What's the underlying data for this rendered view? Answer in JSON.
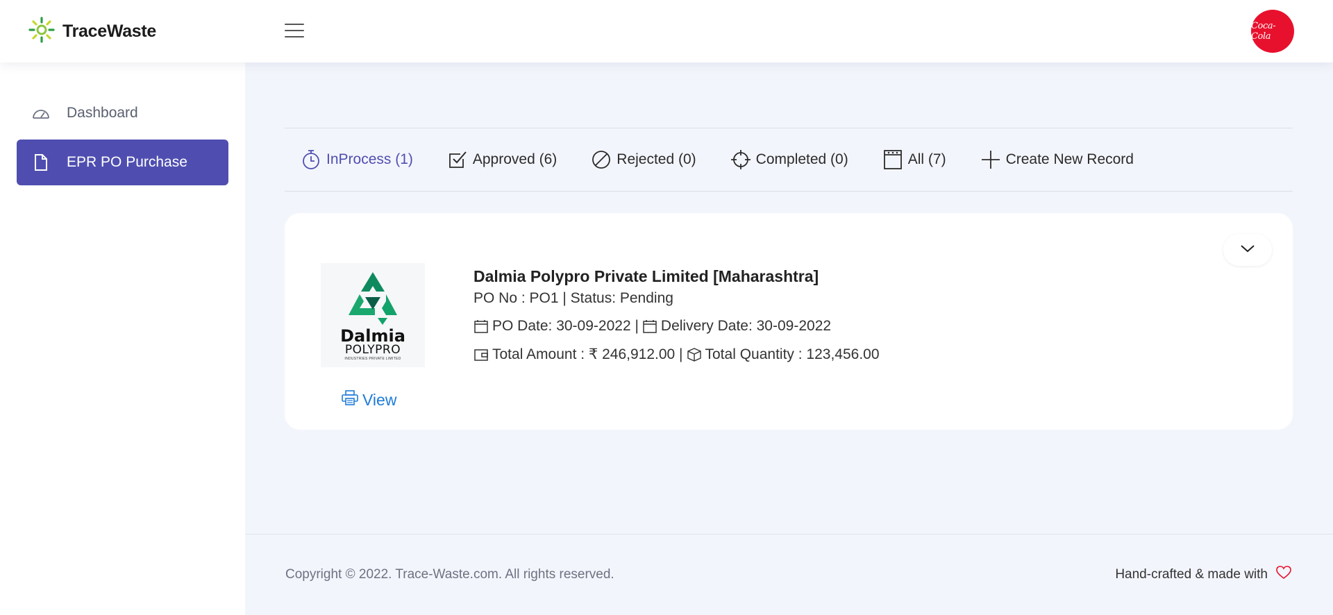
{
  "brand": {
    "name": "TraceWaste"
  },
  "header": {
    "avatar_text": "Coca-Cola"
  },
  "sidebar": {
    "items": [
      {
        "label": "Dashboard",
        "icon": "speedometer-icon"
      },
      {
        "label": "EPR PO Purchase",
        "icon": "document-icon",
        "active": true
      }
    ]
  },
  "tabs": [
    {
      "label": "InProcess (1)",
      "icon": "timer-icon",
      "active": true
    },
    {
      "label": "Approved (6)",
      "icon": "checkbox-icon"
    },
    {
      "label": "Rejected (0)",
      "icon": "slash-circle-icon"
    },
    {
      "label": "Completed (0)",
      "icon": "crosshair-icon"
    },
    {
      "label": "All (7)",
      "icon": "calendar-icon"
    },
    {
      "label": "Create New Record",
      "icon": "plus-icon"
    }
  ],
  "record": {
    "company": "Dalmia Polypro Private Limited [Maharashtra]",
    "po_status": "PO No : PO1 | Status: Pending",
    "po_date": "PO Date: 30-09-2022 |",
    "delivery_date": "Delivery Date: 30-09-2022",
    "total_amount": "Total Amount : ₹ 246,912.00 |",
    "total_quantity": "Total Quantity : 123,456.00",
    "view_label": "View",
    "logo": {
      "word": "Dalmia",
      "sub": "POLYPRO",
      "tiny": "INDUSTRIES PRIVATE LIMITED"
    }
  },
  "footer": {
    "copyright": "Copyright © 2022. Trace-Waste.com. All rights reserved.",
    "crafted": "Hand-crafted & made with"
  },
  "colors": {
    "accent": "#4f4eb0",
    "link": "#1e7bd8",
    "brand_red": "#e8112d",
    "heart": "#e8112d"
  }
}
